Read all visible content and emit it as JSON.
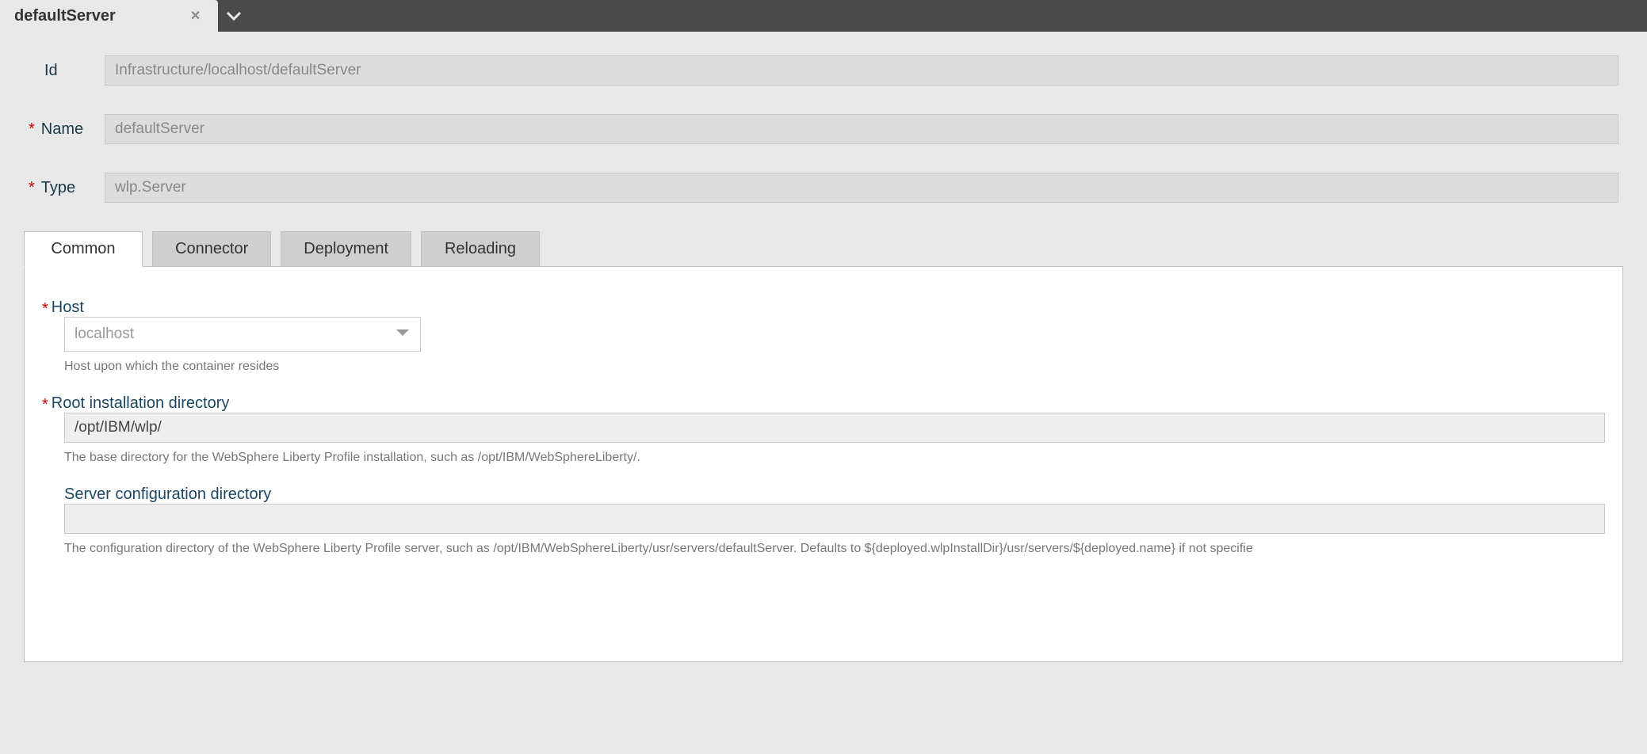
{
  "header": {
    "tabTitle": "defaultServer"
  },
  "form": {
    "id": {
      "label": "Id",
      "value": "Infrastructure/localhost/defaultServer"
    },
    "name": {
      "label": "Name",
      "value": "defaultServer"
    },
    "type": {
      "label": "Type",
      "value": "wlp.Server"
    }
  },
  "tabs": [
    {
      "label": "Common",
      "active": true
    },
    {
      "label": "Connector",
      "active": false
    },
    {
      "label": "Deployment",
      "active": false
    },
    {
      "label": "Reloading",
      "active": false
    }
  ],
  "common": {
    "host": {
      "label": "Host",
      "value": "localhost",
      "help": "Host upon which the container resides"
    },
    "rootDir": {
      "label": "Root installation directory",
      "value": "/opt/IBM/wlp/",
      "help": "The base directory for the WebSphere Liberty Profile installation, such as /opt/IBM/WebSphereLiberty/."
    },
    "serverConfigDir": {
      "label": "Server configuration directory",
      "value": "",
      "help": "The configuration directory of the WebSphere Liberty Profile server, such as /opt/IBM/WebSphereLiberty/usr/servers/defaultServer. Defaults to ${deployed.wlpInstallDir}/usr/servers/${deployed.name} if not specifie"
    }
  }
}
